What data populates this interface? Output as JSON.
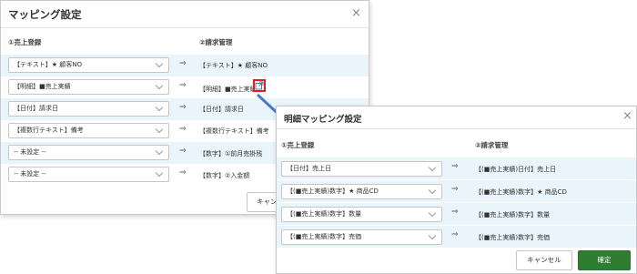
{
  "back_dialog": {
    "title": "マッピング設定",
    "close_icon": "×",
    "col_left": "①売上登録",
    "col_right": "②請求管理",
    "arrow_glyph": "⇒",
    "rows": [
      {
        "select": "【テキスト】★ 顧客NO",
        "target": "【テキスト】★ 顧客NO"
      },
      {
        "select": "【明細】■売上実績",
        "target": "【明細】■売上実績"
      },
      {
        "select": "【日付】請求日",
        "target": "【日付】請求日"
      },
      {
        "select": "【複数行テキスト】備考",
        "target": "【複数行テキスト】備考"
      },
      {
        "select": "-- 未設定 --",
        "target": "【数字】①前月売掛残"
      },
      {
        "select": "-- 未設定 --",
        "target": "【数字】②入金額"
      }
    ],
    "cancel_label": "キャン"
  },
  "front_dialog": {
    "title": "明細マッピング設定",
    "close_icon": "×",
    "col_left": "①売上登録",
    "col_right": "②請求管理",
    "arrow_glyph": "⇒",
    "rows": [
      {
        "select": "【日付】売上日",
        "target": "【(■売上実績)日付】売上日"
      },
      {
        "select": "【(■売上実績)数字】★ 商品CD",
        "target": "【(■売上実績)数字】★ 商品CD"
      },
      {
        "select": "【(■売上実績)数字】数量",
        "target": "【(■売上実績)数字】数量"
      },
      {
        "select": "【(■売上実績)数字】売価",
        "target": "【(■売上実績)数字】売価"
      }
    ],
    "cancel_label": "キャンセル",
    "confirm_label": "確定"
  },
  "icons": {
    "open_detail": "external-link-icon",
    "highlight_color": "#e02020",
    "pointer_arrow_color": "#4a78c8"
  },
  "colors": {
    "row_blue": "#e9f4fb",
    "confirm_green": "#2e7d32"
  }
}
